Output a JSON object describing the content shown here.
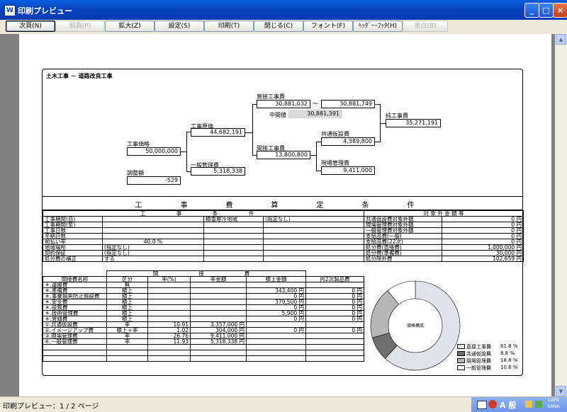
{
  "window": {
    "title": "印刷プレビュー"
  },
  "toolbar": {
    "next": "次頁(N)",
    "prev": "前頁(P)",
    "zoom": "拡大(Z)",
    "setup": "設定(S)",
    "print": "印刷(T)",
    "close": "閉じる(C)",
    "font": "フォント(F)",
    "header_footer": "ﾍｯﾀﾞｰ･ﾌｯﾀ(H)",
    "margin": "余白(B)"
  },
  "status": {
    "text": "印刷プレビュー：1 / 2 ページ",
    "caps": "CAPS",
    "kana": "KANA"
  },
  "report": {
    "title": "土木工事 － 道路改良工事",
    "tree": {
      "koji_kakaku_label": "工事価格",
      "koji_kakaku": "50,000,000",
      "chosei_label": "調整額",
      "chosei": "-529",
      "koji_genka_label": "工事原価",
      "koji_genka": "44,682,191",
      "ippan_label": "一般管理費",
      "ippan": "5,318,338",
      "chokusetsu_label": "直接工事費",
      "chokusetsu_a": "30,881,032",
      "chokusetsu_b": "30,881,749",
      "tilde": "～",
      "chukan_label": "中間値",
      "chukan": "30,881,391",
      "kansetsu_label": "間接工事費",
      "kansetsu": "13,800,800",
      "junkoji_label": "純工事費",
      "junkoji": "35,271,191",
      "kyotsu_label": "共通仮設費",
      "kyotsu": "4,389,800",
      "genba_label": "現場管理費",
      "genba": "9,411,000"
    },
    "conditions_title": "工　事　費　算　定　条　件",
    "cond_header": "工　事　条　件",
    "cond_rows": [
      [
        "工事期間(自)",
        "",
        "積雪寒冷地域",
        "(指定なし)"
      ],
      [
        "工事期間(至)",
        "",
        "",
        ""
      ],
      [
        "工事日数",
        "",
        "",
        ""
      ],
      [
        "冬期日数",
        "",
        "",
        ""
      ],
      [
        "前払い率",
        "40.0 %",
        "",
        ""
      ],
      [
        "地域場所",
        "(指定なし)",
        "",
        ""
      ],
      [
        "契約保証",
        "(指定なし)",
        "",
        ""
      ],
      [
        "処分費の補正",
        "する",
        "",
        ""
      ]
    ],
    "excl_header": "対 象 外 金 額 等",
    "excl_rows": [
      [
        "共通仮設費対象外額",
        "0 円"
      ],
      [
        "現場管理費対象外額",
        "0 円"
      ],
      [
        "一般管理費対象外額",
        "0 円"
      ],
      [
        "支給品費(一般)",
        "0 円"
      ],
      [
        "支給品費(22次)",
        "0 円"
      ],
      [
        "処分費(直接費)",
        "1,000,000 円"
      ],
      [
        "処分費(準備費)",
        "30,000 円"
      ],
      [
        "処分除外費",
        "102,659 円"
      ]
    ],
    "kansetsu_header": "間　　接　　費",
    "k_cols": [
      "間接費名称",
      "区分",
      "率(%)",
      "率金額",
      "積上金額",
      "内2次製品費"
    ],
    "k_rows": [
      [
        "＊.運搬費",
        "無",
        "",
        "",
        "",
        ""
      ],
      [
        "＊.準備費",
        "積上",
        "",
        "",
        "343,400 円",
        "0 円"
      ],
      [
        "＊.事業損失防止施設費",
        "積上",
        "",
        "",
        "0 円",
        "0 円"
      ],
      [
        "＊.安全費",
        "積上",
        "",
        "",
        "379,500 円",
        "0 円"
      ],
      [
        "＊.役務費",
        "積上",
        "",
        "",
        "0 円",
        "0 円"
      ],
      [
        "＊.技術管理費",
        "積上",
        "",
        "",
        "5,900 円",
        "0 円"
      ],
      [
        "＊.営繕費",
        "積上",
        "",
        "",
        "0 円",
        "0 円"
      ],
      [
        "①.共通仮設費",
        "率",
        "10.91",
        "3,357,000 円",
        "",
        ""
      ],
      [
        "②.イメージアップ費",
        "積上＋率",
        "1.02",
        "304,000 円",
        "0 円",
        "0 円"
      ],
      [
        "③.現場管理費",
        "率",
        "26.76",
        "9,411,000 円",
        "",
        ""
      ],
      [
        "④.一般管理費",
        "率",
        "11.93",
        "5,318,338 円",
        "",
        ""
      ],
      [
        "",
        "",
        "",
        "",
        "",
        ""
      ],
      [
        "",
        "",
        "",
        "",
        "",
        ""
      ],
      [
        "",
        "",
        "",
        "",
        "",
        ""
      ]
    ],
    "pie": {
      "center_label": "価格構成",
      "slices": [
        {
          "name": "直接工事費",
          "pct": "61.8 %",
          "value": 61.8,
          "color": "#dfe3ea"
        },
        {
          "name": "共通仮設費",
          "pct": "8.8 %",
          "value": 8.8,
          "color": "#6f6f6f"
        },
        {
          "name": "現場管理費",
          "pct": "18.8 %",
          "value": 18.8,
          "color": "#b6b6b6"
        },
        {
          "name": "一般管理費",
          "pct": "10.6 %",
          "value": 10.6,
          "color": "#ffffff"
        }
      ]
    }
  }
}
